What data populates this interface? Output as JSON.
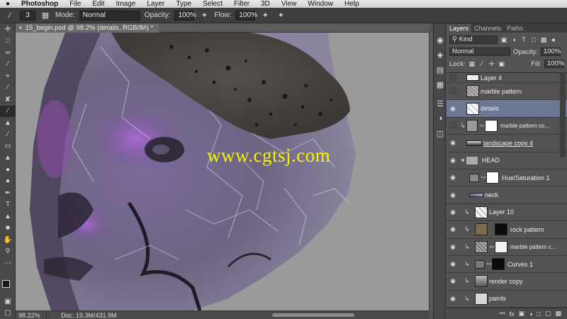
{
  "menubar": {
    "apple": "",
    "items": [
      "Photoshop",
      "File",
      "Edit",
      "Image",
      "Layer",
      "Type",
      "Select",
      "Filter",
      "3D",
      "View",
      "Window",
      "Help"
    ]
  },
  "options": {
    "brush_size": "3",
    "mode_label": "Mode:",
    "mode_value": "Normal",
    "opacity_label": "Opacity:",
    "opacity_value": "100%",
    "flow_label": "Flow:",
    "flow_value": "100%"
  },
  "document": {
    "tab_title": "15_begin.psd @ 98.2% (details, RGB/8#) *",
    "watermark": "www.cgtsj.com"
  },
  "status": {
    "zoom": "98.22%",
    "doc_size": "Doc: 19.3M/431.9M"
  },
  "panel": {
    "tabs": [
      "Layers",
      "Channels",
      "Paths"
    ],
    "filter_label": "Kind",
    "blend_mode": "Normal",
    "opacity_label": "Opacity:",
    "opacity_value": "100%",
    "lock_label": "Lock:",
    "fill_label": "Fill:",
    "fill_value": "100%"
  },
  "layers": [
    {
      "name": "Layer 4",
      "visible": false
    },
    {
      "name": "marble pattern",
      "visible": false
    },
    {
      "name": "details",
      "visible": true,
      "selected": true
    },
    {
      "name": "marble pattern co...",
      "visible": false
    },
    {
      "name": "landscape copy 4",
      "visible": true
    },
    {
      "name": "HEAD",
      "visible": true
    },
    {
      "name": "Hue/Saturation 1",
      "visible": true
    },
    {
      "name": "neck",
      "visible": true
    },
    {
      "name": "Layer 10",
      "visible": true
    },
    {
      "name": "rock pattern",
      "visible": true
    },
    {
      "name": "marble pattern c...",
      "visible": true
    },
    {
      "name": "Curves 1",
      "visible": true
    },
    {
      "name": "render copy",
      "visible": true
    },
    {
      "name": "paints",
      "visible": true
    }
  ],
  "colors": {
    "selected_layer": "#6c7891",
    "watermark": "#f4f400",
    "canvas_bg": "#9a9a9a"
  }
}
